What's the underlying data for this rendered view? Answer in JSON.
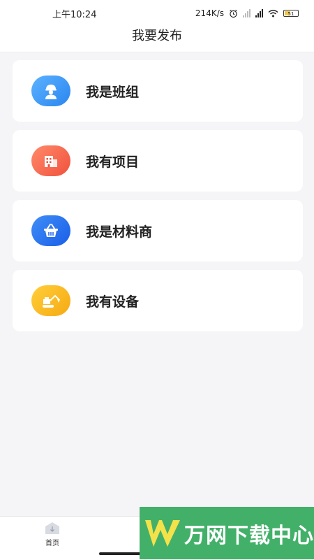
{
  "status_bar": {
    "time": "上午10:24",
    "net_speed": "214K/s",
    "battery": "51"
  },
  "header": {
    "title": "我要发布"
  },
  "cards": [
    {
      "label": "我是班组",
      "icon": "worker-icon",
      "colors": [
        "#5cb2ff",
        "#2a86f0"
      ]
    },
    {
      "label": "我有项目",
      "icon": "building-icon",
      "colors": [
        "#ff8a6a",
        "#f0513d"
      ]
    },
    {
      "label": "我是材料商",
      "icon": "basket-icon",
      "colors": [
        "#3f8ef7",
        "#1a5ee8"
      ]
    },
    {
      "label": "我有设备",
      "icon": "excavator-icon",
      "colors": [
        "#ffcf3a",
        "#f6a912"
      ]
    }
  ],
  "tabbar": {
    "home_label": "首页"
  },
  "watermark": {
    "text": "万网下载中心"
  }
}
